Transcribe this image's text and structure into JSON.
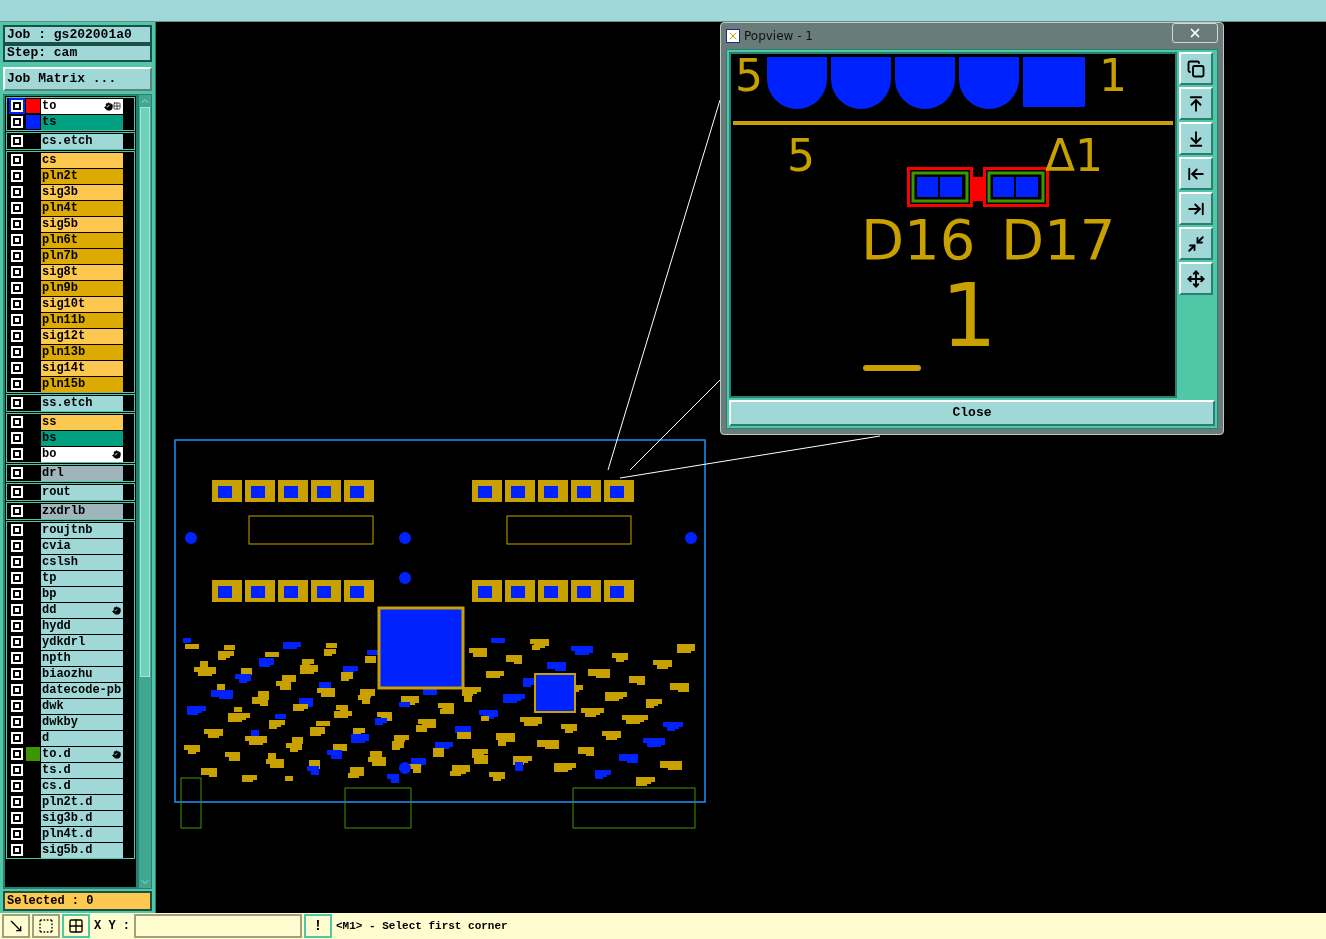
{
  "job": "Job : gs202001a0",
  "step": "Step: cam",
  "job_matrix_button": "Job Matrix ...",
  "layer_groups": [
    {
      "layers": [
        {
          "name": "to",
          "kind": "board",
          "color": "#ff0000",
          "work": true,
          "hand": true,
          "grid": true
        },
        {
          "name": "ts",
          "kind": "mask",
          "color": "#0022ff",
          "work": false,
          "hand": false,
          "grid": false
        }
      ]
    },
    {
      "layers": [
        {
          "name": "cs.etch",
          "kind": "doc",
          "work": false,
          "hand": false,
          "grid": false
        }
      ]
    },
    {
      "layers": [
        {
          "name": "cs",
          "kind": "signal",
          "work": false,
          "hand": false,
          "grid": false
        },
        {
          "name": "pln2t",
          "kind": "plane",
          "work": false,
          "hand": false,
          "grid": false
        },
        {
          "name": "sig3b",
          "kind": "signal",
          "work": false,
          "hand": false,
          "grid": false
        },
        {
          "name": "pln4t",
          "kind": "plane",
          "work": false,
          "hand": false,
          "grid": false
        },
        {
          "name": "sig5b",
          "kind": "signal",
          "work": false,
          "hand": false,
          "grid": false
        },
        {
          "name": "pln6t",
          "kind": "plane",
          "work": false,
          "hand": false,
          "grid": false
        },
        {
          "name": "pln7b",
          "kind": "plane",
          "work": false,
          "hand": false,
          "grid": false
        },
        {
          "name": "sig8t",
          "kind": "signal",
          "work": false,
          "hand": false,
          "grid": false
        },
        {
          "name": "pln9b",
          "kind": "plane",
          "work": false,
          "hand": false,
          "grid": false
        },
        {
          "name": "sig10t",
          "kind": "signal",
          "work": false,
          "hand": false,
          "grid": false
        },
        {
          "name": "pln11b",
          "kind": "plane",
          "work": false,
          "hand": false,
          "grid": false
        },
        {
          "name": "sig12t",
          "kind": "signal",
          "work": false,
          "hand": false,
          "grid": false
        },
        {
          "name": "pln13b",
          "kind": "plane",
          "work": false,
          "hand": false,
          "grid": false
        },
        {
          "name": "sig14t",
          "kind": "signal",
          "work": false,
          "hand": false,
          "grid": false
        },
        {
          "name": "pln15b",
          "kind": "plane",
          "work": false,
          "hand": false,
          "grid": false
        }
      ]
    },
    {
      "layers": [
        {
          "name": "ss.etch",
          "kind": "doc",
          "work": false,
          "hand": false,
          "grid": false
        }
      ]
    },
    {
      "layers": [
        {
          "name": "ss",
          "kind": "signal",
          "work": false,
          "hand": false,
          "grid": false
        },
        {
          "name": "bs",
          "kind": "mask",
          "work": false,
          "hand": false,
          "grid": false
        },
        {
          "name": "bo",
          "kind": "board",
          "work": false,
          "hand": true,
          "grid": false
        }
      ]
    },
    {
      "layers": [
        {
          "name": "drl",
          "kind": "drill",
          "work": false,
          "hand": false,
          "grid": false
        }
      ]
    },
    {
      "layers": [
        {
          "name": "rout",
          "kind": "doc",
          "work": false,
          "hand": false,
          "grid": false
        }
      ]
    },
    {
      "layers": [
        {
          "name": "zxdrlb",
          "kind": "drill",
          "work": false,
          "hand": false,
          "grid": false
        }
      ]
    },
    {
      "layers": [
        {
          "name": "roujtnb",
          "kind": "doc",
          "work": false,
          "hand": false,
          "grid": false
        },
        {
          "name": "cvia",
          "kind": "doc",
          "work": false,
          "hand": false,
          "grid": false
        },
        {
          "name": "cslsh",
          "kind": "doc",
          "work": false,
          "hand": false,
          "grid": false
        },
        {
          "name": "tp",
          "kind": "doc",
          "work": false,
          "hand": false,
          "grid": false
        },
        {
          "name": "bp",
          "kind": "doc",
          "work": false,
          "hand": false,
          "grid": false
        },
        {
          "name": "dd",
          "kind": "doc",
          "work": false,
          "hand": true,
          "grid": false
        },
        {
          "name": "hydd",
          "kind": "doc",
          "work": false,
          "hand": false,
          "grid": false
        },
        {
          "name": "ydkdrl",
          "kind": "doc",
          "work": false,
          "hand": false,
          "grid": false
        },
        {
          "name": "npth",
          "kind": "doc",
          "work": false,
          "hand": false,
          "grid": false
        },
        {
          "name": "biaozhu",
          "kind": "doc",
          "work": false,
          "hand": false,
          "grid": false
        },
        {
          "name": "datecode-pb",
          "kind": "doc",
          "work": false,
          "hand": false,
          "grid": false
        },
        {
          "name": "dwk",
          "kind": "doc",
          "work": false,
          "hand": false,
          "grid": false
        },
        {
          "name": "dwkby",
          "kind": "doc",
          "work": false,
          "hand": false,
          "grid": false
        },
        {
          "name": "d",
          "kind": "doc",
          "work": false,
          "hand": false,
          "grid": false
        },
        {
          "name": "to.d",
          "kind": "doc",
          "color": "#3c9600",
          "work": false,
          "hand": true,
          "grid": false
        },
        {
          "name": "ts.d",
          "kind": "doc",
          "work": false,
          "hand": false,
          "grid": false
        },
        {
          "name": "cs.d",
          "kind": "doc",
          "work": false,
          "hand": false,
          "grid": false
        },
        {
          "name": "pln2t.d",
          "kind": "doc",
          "work": false,
          "hand": false,
          "grid": false
        },
        {
          "name": "sig3b.d",
          "kind": "doc",
          "work": false,
          "hand": false,
          "grid": false
        },
        {
          "name": "pln4t.d",
          "kind": "doc",
          "work": false,
          "hand": false,
          "grid": false
        },
        {
          "name": "sig5b.d",
          "kind": "doc",
          "work": false,
          "hand": false,
          "grid": false
        }
      ]
    }
  ],
  "selected_count": "Selected : 0",
  "popview": {
    "title": "Popview - 1",
    "close_button": "Close",
    "view_labels": [
      "5",
      "1",
      "5",
      "Δ1",
      "D16",
      "D17",
      "1"
    ]
  },
  "status_bar": {
    "xy_label": "X Y :",
    "alert_button": "!",
    "message": "<M1> - Select first corner"
  }
}
